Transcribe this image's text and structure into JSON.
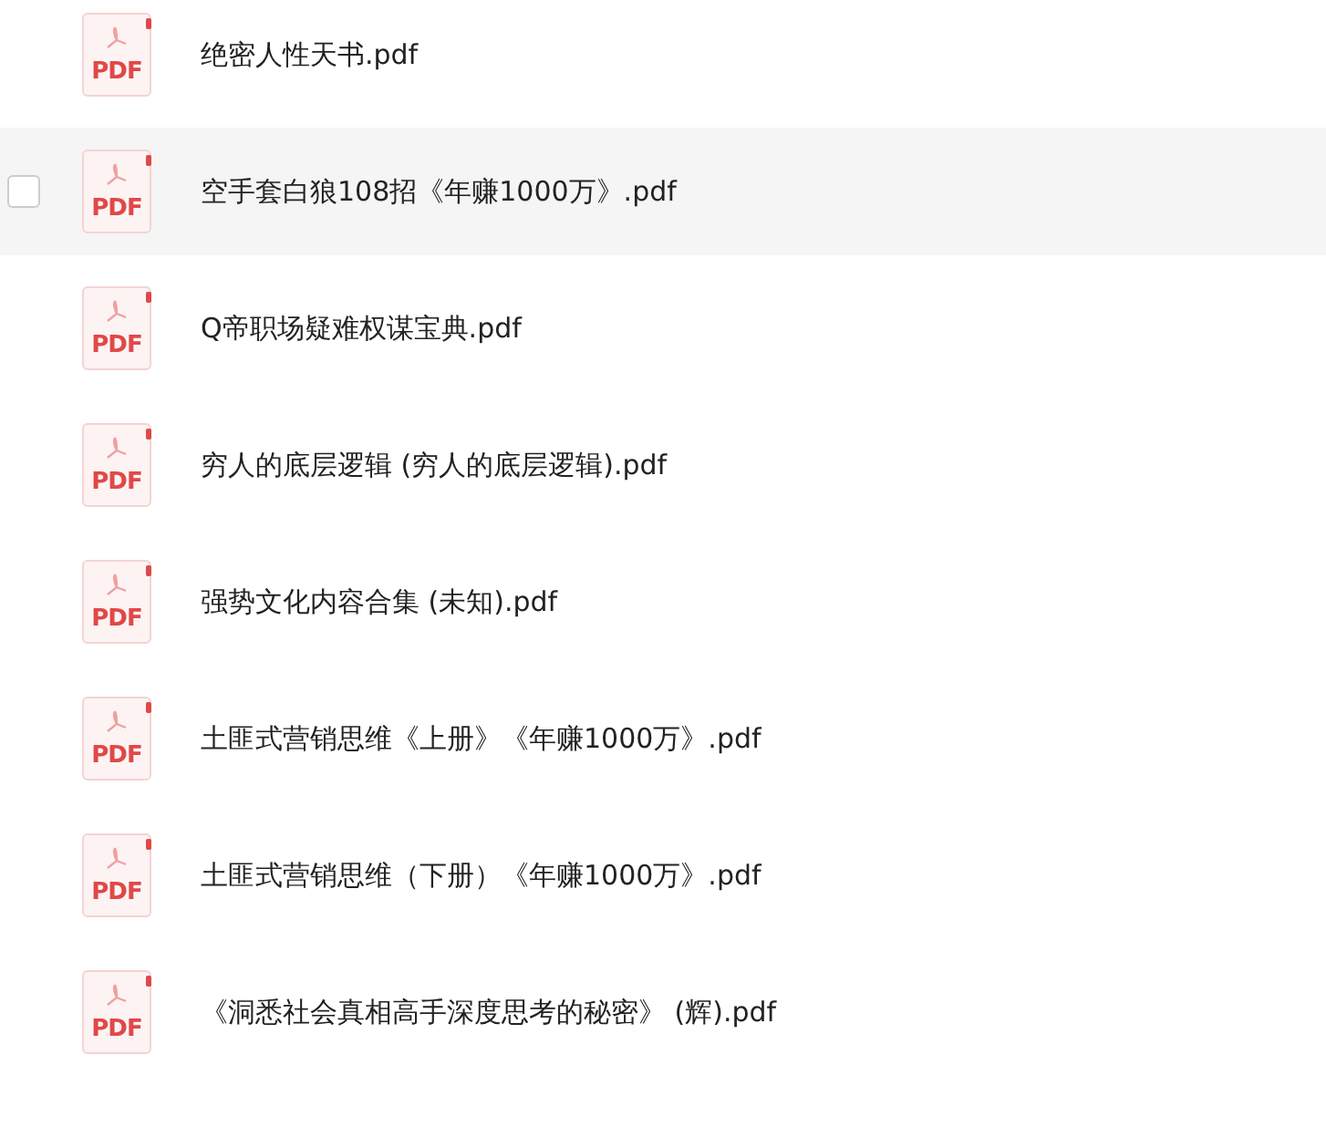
{
  "files": [
    {
      "name": "绝密人性天书.pdf",
      "type_label": "PDF",
      "hovered": false
    },
    {
      "name": "空手套白狼108招《年赚1000万》.pdf",
      "type_label": "PDF",
      "hovered": true
    },
    {
      "name": "Q帝职场疑难权谋宝典.pdf",
      "type_label": "PDF",
      "hovered": false
    },
    {
      "name": "穷人的底层逻辑 (穷人的底层逻辑).pdf",
      "type_label": "PDF",
      "hovered": false
    },
    {
      "name": "强势文化内容合集 (未知).pdf",
      "type_label": "PDF",
      "hovered": false
    },
    {
      "name": "土匪式营销思维《上册》《年赚1000万》.pdf",
      "type_label": "PDF",
      "hovered": false
    },
    {
      "name": "土匪式营销思维（下册）《年赚1000万》.pdf",
      "type_label": "PDF",
      "hovered": false
    },
    {
      "name": "《洞悉社会真相高手深度思考的秘密》 (辉).pdf",
      "type_label": "PDF",
      "hovered": false
    }
  ]
}
